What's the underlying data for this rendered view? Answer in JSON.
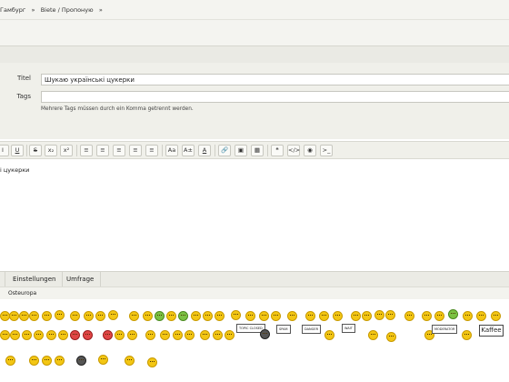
{
  "breadcrumb": {
    "items": [
      "Гамбург",
      "Biete / Пропоную"
    ]
  },
  "form": {
    "title_label": "Titel",
    "title_value": "Шукаю українські цукерки",
    "tags_label": "Tags",
    "tags_value": "",
    "tags_hint": "Mehrere Tags müssen durch ein Komma getrennt werden."
  },
  "toolbar": {
    "buttons": [
      "underline-button",
      "strikethrough-button",
      "subscript-button",
      "superscript-button",
      "ordered-list-button",
      "unordered-list-button",
      "align-left-button",
      "align-center-button",
      "align-right-button",
      "font-size-button",
      "text-size-button",
      "text-color-button",
      "link-button",
      "image-button",
      "table-button",
      "quote-button",
      "code-button",
      "spoiler-button",
      "source-button"
    ],
    "labels": {
      "underline": "U",
      "strike": "S",
      "subscript": "x₂",
      "superscript": "x²",
      "font_size": "Aa",
      "text_size": "A±",
      "text_color": "A",
      "quote": "❝",
      "code": "</>",
      "source": ">_"
    }
  },
  "editor": {
    "content": "і цукерки"
  },
  "tabs": {
    "settings": "Einstellungen",
    "poll": "Umfrage"
  },
  "smiley_tab": {
    "category": "Osteuropa"
  },
  "smileys": {
    "kaffee_label": "Kaffee",
    "sign_topic_closed": "TOPIC CLOSED",
    "sign_spam": "SPAM",
    "sign_danger": "DANGER",
    "sign_wait": "WAIT",
    "sign_moderator": "MODERATOR"
  }
}
